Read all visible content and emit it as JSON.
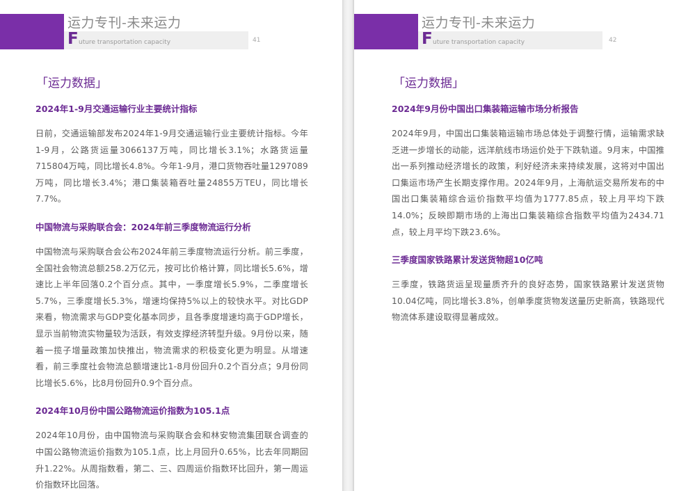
{
  "colors": {
    "accent": "#7a2fa8",
    "title_purple": "#6b2a93",
    "header_gray": "#8a8a8a",
    "body_text": "#5a5a5a"
  },
  "pages": [
    {
      "header_title": "运力专刊-未来运力",
      "header_initial": "F",
      "header_subtitle": "uture transportation capacity",
      "page_number": "41",
      "section_tag": "「运力数据」",
      "articles": [
        {
          "title": "2024年1-9月交通运输行业主要统计指标",
          "body": "日前，交通运输部发布2024年1-9月交通运输行业主要统计指标。今年1-9月，公路货运量3066137万吨，同比增长3.1%；水路货运量715804万吨，同比增长4.8%。今年1-9月，港口货物吞吐量1297089万吨，同比增长3.4%；港口集装箱吞吐量24855万TEU，同比增长7.7%。"
        },
        {
          "title": "中国物流与采购联合会：2024年前三季度物流运行分析",
          "body": "中国物流与采购联合会公布2024年前三季度物流运行分析。前三季度，全国社会物流总额258.2万亿元，按可比价格计算，同比增长5.6%，增速比上半年回落0.2个百分点。其中，一季度增长5.9%，二季度增长5.7%，三季度增长5.3%，增速均保持5%以上的较快水平。对比GDP来看，物流需求与GDP变化基本同步，且各季度增速均高于GDP增长，显示当前物流实物量较为活跃，有效支撑经济转型升级。9月份以来，随着一揽子增量政策加快推出，物流需求的积极变化更为明显。从增速看，前三季度社会物流总额增速比1-8月份回升0.2个百分点；9月份同比增长5.6%，比8月份回升0.9个百分点。"
        },
        {
          "title": "2024年10月份中国公路物流运价指数为105.1点",
          "body": "2024年10月份，由中国物流与采购联合会和林安物流集团联合调查的中国公路物流运价指数为105.1点，比上月回升0.65%，比去年同期回升1.22%。从周指数看，第二、三、四周运价指数环比回升，第一周运价指数环比回落。"
        }
      ]
    },
    {
      "header_title": "运力专刊-未来运力",
      "header_initial": "F",
      "header_subtitle": "uture transportation capacity",
      "page_number": "42",
      "section_tag": "「运力数据」",
      "articles": [
        {
          "title": "2024年9月份中国出口集装箱运输市场分析报告",
          "body": "2024年9月，中国出口集装箱运输市场总体处于调整行情，运输需求缺乏进一步增长的动能，远洋航线市场运价处于下跌轨道。9月末，中国推出一系列推动经济增长的政策，利好经济未来持续发展，这将对中国出口集运市场产生长期支撑作用。2024年9月，上海航运交易所发布的中国出口集装箱综合运价指数平均值为1777.85点，较上月平均下跌14.0%；反映即期市场的上海出口集装箱综合指数平均值为2434.71点，较上月平均下跌23.6%。"
        },
        {
          "title": "三季度国家铁路累计发送货物超10亿吨",
          "body": "三季度，铁路货运呈现量质齐升的良好态势，国家铁路累计发送货物10.04亿吨，同比增长3.8%，创单季度货物发送量历史新高，铁路现代物流体系建设取得显著成效。"
        }
      ]
    }
  ]
}
